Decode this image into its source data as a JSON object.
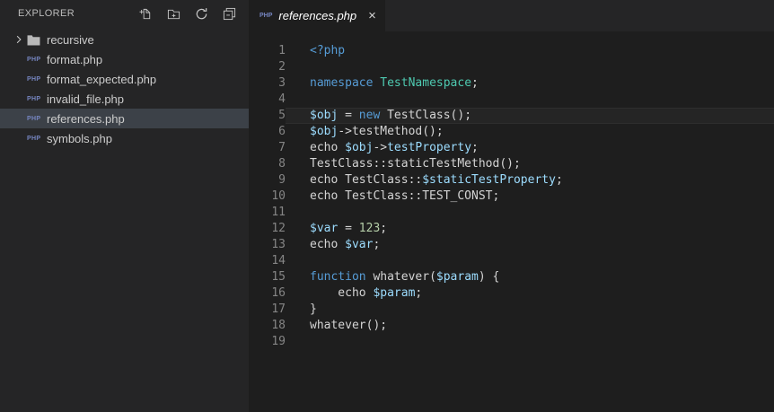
{
  "colors": {
    "kw": "#569cd6",
    "var": "#9cdcfe",
    "cls": "#4ec9b0",
    "num": "#b5cea8",
    "def": "#d4d4d4",
    "line_number": "#858585",
    "sidebar_bg": "#252526",
    "editor_bg": "#1e1e1e",
    "selection_bg": "#3c4148",
    "php_icon": "#7585c0"
  },
  "sidebar": {
    "title": "EXPLORER",
    "actions": [
      {
        "name": "new-file"
      },
      {
        "name": "new-folder"
      },
      {
        "name": "refresh"
      },
      {
        "name": "collapse-all"
      }
    ],
    "files": [
      {
        "label": "recursive",
        "kind": "folder",
        "selected": false
      },
      {
        "label": "format.php",
        "kind": "php",
        "selected": false
      },
      {
        "label": "format_expected.php",
        "kind": "php",
        "selected": false
      },
      {
        "label": "invalid_file.php",
        "kind": "php",
        "selected": false
      },
      {
        "label": "references.php",
        "kind": "php",
        "selected": true
      },
      {
        "label": "symbols.php",
        "kind": "php",
        "selected": false
      }
    ]
  },
  "tabbar": {
    "tabs": [
      {
        "label": "references.php",
        "icon": "PHP",
        "close": "×",
        "active": true,
        "preview": true
      }
    ]
  },
  "editor": {
    "lines": [
      {
        "n": 1,
        "current": false,
        "tokens": [
          {
            "s": "<?php",
            "c": "kw"
          }
        ]
      },
      {
        "n": 2,
        "current": false,
        "tokens": []
      },
      {
        "n": 3,
        "current": false,
        "tokens": [
          {
            "s": "namespace",
            "c": "kw"
          },
          {
            "s": " ",
            "c": "def"
          },
          {
            "s": "TestNamespace",
            "c": "cls"
          },
          {
            "s": ";",
            "c": "def"
          }
        ]
      },
      {
        "n": 4,
        "current": false,
        "tokens": []
      },
      {
        "n": 5,
        "current": true,
        "tokens": [
          {
            "s": "$obj",
            "c": "var"
          },
          {
            "s": " = ",
            "c": "def"
          },
          {
            "s": "new",
            "c": "kw"
          },
          {
            "s": " TestClass();",
            "c": "def"
          }
        ]
      },
      {
        "n": 6,
        "current": false,
        "tokens": [
          {
            "s": "$obj",
            "c": "var"
          },
          {
            "s": "->testMethod();",
            "c": "def"
          }
        ]
      },
      {
        "n": 7,
        "current": false,
        "tokens": [
          {
            "s": "echo ",
            "c": "def"
          },
          {
            "s": "$obj",
            "c": "var"
          },
          {
            "s": "->",
            "c": "def"
          },
          {
            "s": "testProperty",
            "c": "var"
          },
          {
            "s": ";",
            "c": "def"
          }
        ]
      },
      {
        "n": 8,
        "current": false,
        "tokens": [
          {
            "s": "TestClass::staticTestMethod();",
            "c": "def"
          }
        ]
      },
      {
        "n": 9,
        "current": false,
        "tokens": [
          {
            "s": "echo TestClass::",
            "c": "def"
          },
          {
            "s": "$staticTestProperty",
            "c": "var"
          },
          {
            "s": ";",
            "c": "def"
          }
        ]
      },
      {
        "n": 10,
        "current": false,
        "tokens": [
          {
            "s": "echo TestClass::TEST_CONST;",
            "c": "def"
          }
        ]
      },
      {
        "n": 11,
        "current": false,
        "tokens": []
      },
      {
        "n": 12,
        "current": false,
        "tokens": [
          {
            "s": "$var",
            "c": "var"
          },
          {
            "s": " = ",
            "c": "def"
          },
          {
            "s": "123",
            "c": "num"
          },
          {
            "s": ";",
            "c": "def"
          }
        ]
      },
      {
        "n": 13,
        "current": false,
        "tokens": [
          {
            "s": "echo ",
            "c": "def"
          },
          {
            "s": "$var",
            "c": "var"
          },
          {
            "s": ";",
            "c": "def"
          }
        ]
      },
      {
        "n": 14,
        "current": false,
        "tokens": []
      },
      {
        "n": 15,
        "current": false,
        "tokens": [
          {
            "s": "function",
            "c": "kw"
          },
          {
            "s": " whatever(",
            "c": "def"
          },
          {
            "s": "$param",
            "c": "var"
          },
          {
            "s": ") {",
            "c": "def"
          }
        ]
      },
      {
        "n": 16,
        "current": false,
        "tokens": [
          {
            "s": "    echo ",
            "c": "def"
          },
          {
            "s": "$param",
            "c": "var"
          },
          {
            "s": ";",
            "c": "def"
          }
        ]
      },
      {
        "n": 17,
        "current": false,
        "tokens": [
          {
            "s": "}",
            "c": "def"
          }
        ]
      },
      {
        "n": 18,
        "current": false,
        "tokens": [
          {
            "s": "whatever();",
            "c": "def"
          }
        ]
      },
      {
        "n": 19,
        "current": false,
        "tokens": []
      }
    ]
  }
}
